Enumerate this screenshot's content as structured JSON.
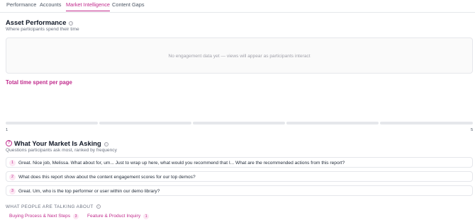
{
  "tabs": [
    {
      "label": "Performance",
      "active": false
    },
    {
      "label": "Accounts",
      "active": false
    },
    {
      "label": "Market Intelligence",
      "active": true
    },
    {
      "label": "Content Gaps",
      "active": false
    }
  ],
  "asset_performance": {
    "title": "Asset Performance",
    "subtitle": "Where participants spend their time",
    "empty_message": "No engagement data yet — views will appear as participants interact",
    "chart_title": "Total time spent per page",
    "axis_start": "1",
    "axis_end": "5"
  },
  "market": {
    "title": "What Your Market Is Asking",
    "subtitle": "Questions participants ask most, ranked by frequency",
    "questions": [
      {
        "rank": "1",
        "text": "Great. Nice job, Melissa. What about for, um... Just to wrap up here, what would you recommend that I... What are the recommended actions from this report?"
      },
      {
        "rank": "2",
        "text": "What does this report show about the content engagement scores for our top demos?"
      },
      {
        "rank": "3",
        "text": "Great. Um, who is the top performer or user within our demo library?"
      }
    ]
  },
  "topics": {
    "title": "WHAT PEOPLE ARE TALKING ABOUT",
    "items": [
      {
        "label": "Buying Process & Next Steps",
        "count": "3"
      },
      {
        "label": "Feature & Product Inquiry",
        "count": "1"
      }
    ]
  },
  "colors": {
    "accent": "#c02a8c",
    "accent_soft": "#fce7f3",
    "border": "#e5e7eb"
  },
  "icons": {
    "info": "info-circle-icon",
    "question": "question-circle-icon"
  }
}
